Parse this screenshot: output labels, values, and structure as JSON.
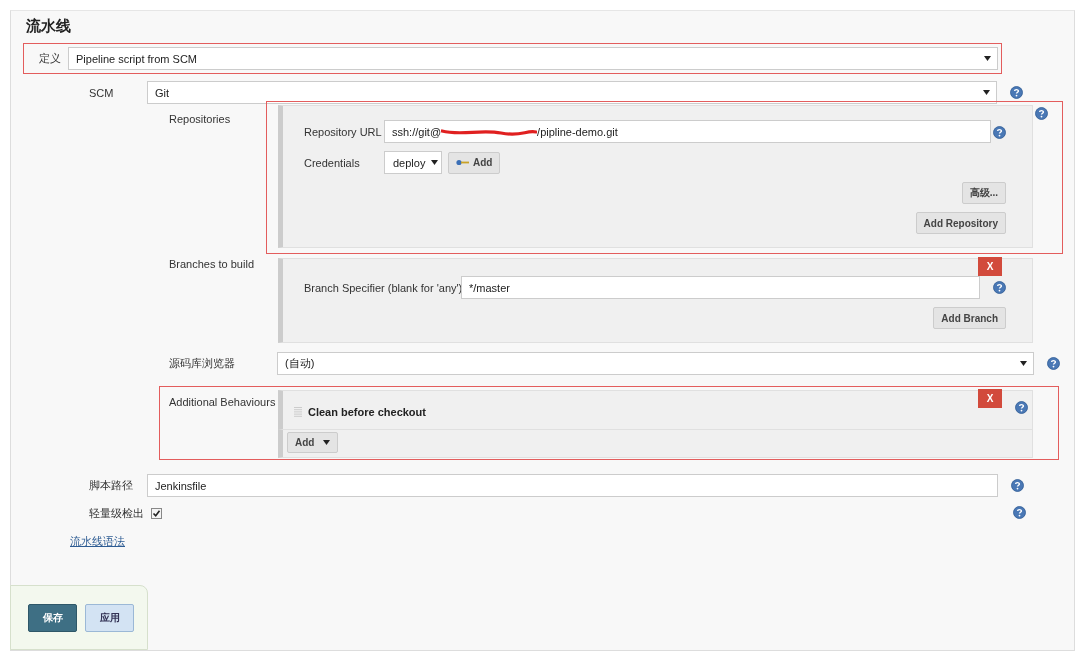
{
  "section_title": "流水线",
  "definition": {
    "label": "定义",
    "value": "Pipeline script from SCM",
    "highlighted": true
  },
  "scm": {
    "label": "SCM",
    "value": "Git"
  },
  "repositories": {
    "label": "Repositories",
    "highlighted": true,
    "url_label": "Repository URL",
    "url_value_start": "ssh://git@",
    "url_redacted": true,
    "url_value_end": "/pipline-demo.git",
    "credentials_label": "Credentials",
    "credentials_value": "deploy",
    "add_button": "Add",
    "advanced_button": "高级...",
    "add_repository_button": "Add Repository"
  },
  "branches": {
    "label": "Branches to build",
    "specifier_label": "Branch Specifier (blank for 'any')",
    "specifier_value": "*/master",
    "delete_button": "X",
    "add_branch_button": "Add Branch"
  },
  "repository_browser": {
    "label": "源码库浏览器",
    "value": "(自动)"
  },
  "additional_behaviours": {
    "label": "Additional Behaviours",
    "highlighted": true,
    "items": [
      {
        "title": "Clean before checkout",
        "delete_button": "X"
      }
    ],
    "add_button": "Add"
  },
  "script_path": {
    "label": "脚本路径",
    "value": "Jenkinsfile"
  },
  "lightweight_checkout": {
    "label": "轻量级检出",
    "checked": true
  },
  "syntax_link": "流水线语法",
  "buttons": [
    {
      "label": "保存",
      "kind": "primary"
    },
    {
      "label": "应用",
      "kind": "secondary"
    }
  ]
}
